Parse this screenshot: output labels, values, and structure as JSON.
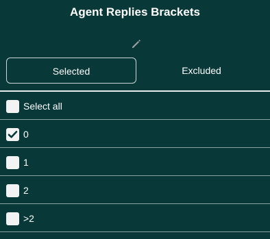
{
  "header": {
    "title": "Agent Replies Brackets"
  },
  "icons": {
    "edit": "pencil-icon"
  },
  "tabs": [
    {
      "label": "Selected",
      "active": true
    },
    {
      "label": "Excluded",
      "active": false
    }
  ],
  "list": {
    "items": [
      {
        "label": "Select all",
        "checked": false
      },
      {
        "label": "0",
        "checked": true
      },
      {
        "label": "1",
        "checked": false
      },
      {
        "label": "2",
        "checked": false
      },
      {
        "label": ">2",
        "checked": false
      }
    ]
  },
  "colors": {
    "background": "#083838",
    "text": "#ffffff",
    "checkbox": "#f3f3f3",
    "checkmark": "#083838"
  }
}
